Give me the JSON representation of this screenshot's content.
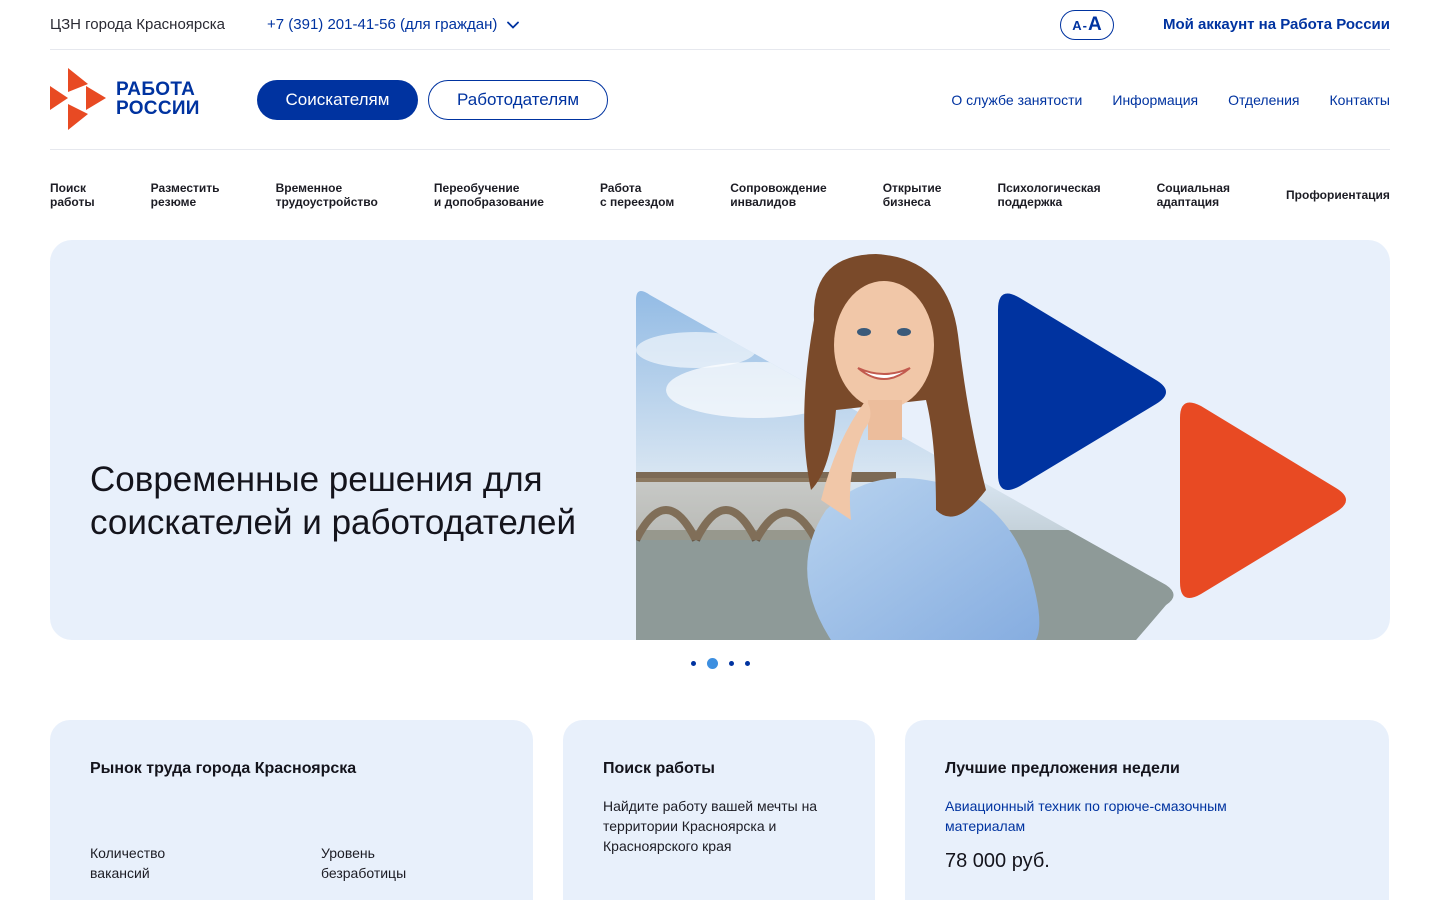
{
  "topbar": {
    "org_name": "ЦЗН города Красноярска",
    "phone": "+7 (391) 201-41-56 (для граждан)",
    "a11y_small": "A",
    "a11y_sep": "-",
    "a11y_big": "A",
    "account_link": "Мой аккаунт на Работа России"
  },
  "header": {
    "logo_line1": "РАБОТА",
    "logo_line2": "РОССИИ",
    "btn_seekers": "Соискателям",
    "btn_employers": "Работодателям",
    "nav": [
      "О службе занятости",
      "Информация",
      "Отделения",
      "Контакты"
    ]
  },
  "services": [
    "Поиск\nработы",
    "Разместить\nрезюме",
    "Временное\nтрудоустройство",
    "Переобучение\nи допобразование",
    "Работа\nс переездом",
    "Сопровождение\nинвалидов",
    "Открытие\nбизнеса",
    "Психологическая\nподдержка",
    "Социальная\nадаптация",
    "Профориентация"
  ],
  "hero": {
    "title": "Современные решения для соискателей и работодателей",
    "slides_total": 4,
    "active_slide": 2
  },
  "cards": {
    "market": {
      "title": "Рынок труда города Красноярска",
      "stat1_label": "Количество\nвакансий",
      "stat2_label": "Уровень\nбезработицы"
    },
    "jobsearch": {
      "title": "Поиск работы",
      "text": "Найдите работу вашей мечты на территории Красноярска и Красноярского края"
    },
    "offers": {
      "title": "Лучшие предложения недели",
      "vacancy": "Авиационный техник по горюче-смазочным материалам",
      "salary": "78 000 руб."
    }
  },
  "colors": {
    "brand_blue": "#0033a0",
    "brand_red": "#e84a23",
    "card_bg": "#e8f0fb",
    "dot_active": "#3d8fe0"
  }
}
